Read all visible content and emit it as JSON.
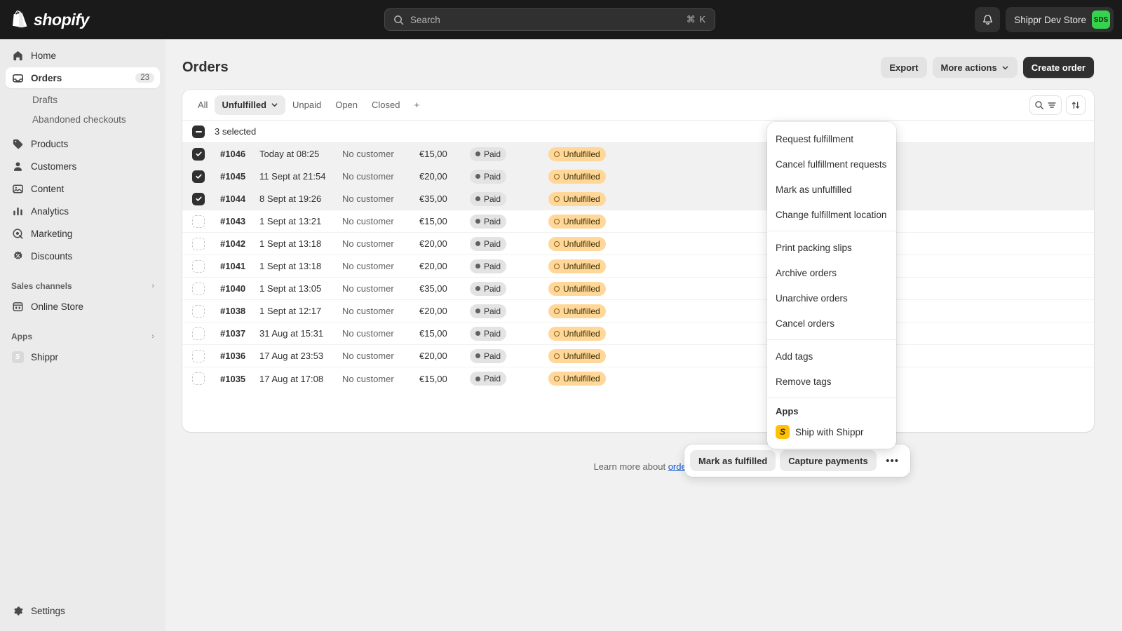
{
  "topbar": {
    "brand": "shopify",
    "search": {
      "placeholder": "Search",
      "shortcut": "⌘ K"
    },
    "store_name": "Shippr Dev Store",
    "store_initials": "SDS",
    "accent_green": "#36d34e"
  },
  "sidebar": {
    "items": [
      {
        "label": "Home",
        "icon": "home-icon",
        "badge": ""
      },
      {
        "label": "Orders",
        "icon": "orders-icon",
        "badge": "23",
        "active": true
      },
      {
        "label": "Products",
        "icon": "products-icon",
        "badge": ""
      },
      {
        "label": "Customers",
        "icon": "customers-icon",
        "badge": ""
      },
      {
        "label": "Content",
        "icon": "content-icon",
        "badge": ""
      },
      {
        "label": "Analytics",
        "icon": "analytics-icon",
        "badge": ""
      },
      {
        "label": "Marketing",
        "icon": "marketing-icon",
        "badge": ""
      },
      {
        "label": "Discounts",
        "icon": "discounts-icon",
        "badge": ""
      }
    ],
    "sub_items": [
      {
        "label": "Drafts"
      },
      {
        "label": "Abandoned checkouts"
      }
    ],
    "sales_channels": {
      "title": "Sales channels",
      "items": [
        {
          "label": "Online Store",
          "icon": "store-icon"
        }
      ]
    },
    "apps": {
      "title": "Apps",
      "items": [
        {
          "label": "Shippr",
          "icon": "shippr-icon"
        }
      ]
    },
    "settings": {
      "label": "Settings",
      "icon": "gear-icon"
    }
  },
  "page": {
    "title": "Orders",
    "actions": {
      "export": "Export",
      "more_actions": "More actions",
      "create_order": "Create order"
    }
  },
  "tabs": [
    {
      "label": "All",
      "active": false
    },
    {
      "label": "Unfulfilled",
      "active": true,
      "has_chevron": true
    },
    {
      "label": "Unpaid",
      "active": false
    },
    {
      "label": "Open",
      "active": false
    },
    {
      "label": "Closed",
      "active": false
    },
    {
      "label": "+",
      "active": false
    }
  ],
  "table": {
    "selected_label": "3 selected",
    "rows": [
      {
        "order": "#1046",
        "date": "Today at 08:25",
        "customer": "No customer",
        "total": "€15,00",
        "payment": "Paid",
        "fulfillment": "Unfulfilled",
        "selected": true
      },
      {
        "order": "#1045",
        "date": "11 Sept at 21:54",
        "customer": "No customer",
        "total": "€20,00",
        "payment": "Paid",
        "fulfillment": "Unfulfilled",
        "selected": true
      },
      {
        "order": "#1044",
        "date": "8 Sept at 19:26",
        "customer": "No customer",
        "total": "€35,00",
        "payment": "Paid",
        "fulfillment": "Unfulfilled",
        "selected": true
      },
      {
        "order": "#1043",
        "date": "1 Sept at 13:21",
        "customer": "No customer",
        "total": "€15,00",
        "payment": "Paid",
        "fulfillment": "Unfulfilled",
        "selected": false
      },
      {
        "order": "#1042",
        "date": "1 Sept at 13:18",
        "customer": "No customer",
        "total": "€20,00",
        "payment": "Paid",
        "fulfillment": "Unfulfilled",
        "selected": false
      },
      {
        "order": "#1041",
        "date": "1 Sept at 13:18",
        "customer": "No customer",
        "total": "€20,00",
        "payment": "Paid",
        "fulfillment": "Unfulfilled",
        "selected": false
      },
      {
        "order": "#1040",
        "date": "1 Sept at 13:05",
        "customer": "No customer",
        "total": "€35,00",
        "payment": "Paid",
        "fulfillment": "Unfulfilled",
        "selected": false
      },
      {
        "order": "#1038",
        "date": "1 Sept at 12:17",
        "customer": "No customer",
        "total": "€20,00",
        "payment": "Paid",
        "fulfillment": "Unfulfilled",
        "selected": false
      },
      {
        "order": "#1037",
        "date": "31 Aug at 15:31",
        "customer": "No customer",
        "total": "€15,00",
        "payment": "Paid",
        "fulfillment": "Unfulfilled",
        "selected": false
      },
      {
        "order": "#1036",
        "date": "17 Aug at 23:53",
        "customer": "No customer",
        "total": "€20,00",
        "payment": "Paid",
        "fulfillment": "Unfulfilled",
        "selected": false
      },
      {
        "order": "#1035",
        "date": "17 Aug at 17:08",
        "customer": "No customer",
        "total": "€15,00",
        "payment": "Paid",
        "fulfillment": "Unfulfilled",
        "selected": false
      }
    ]
  },
  "menu": {
    "group1": [
      "Request fulfillment",
      "Cancel fulfillment requests",
      "Mark as unfulfilled",
      "Change fulfillment location"
    ],
    "group2": [
      "Print packing slips",
      "Archive orders",
      "Unarchive orders",
      "Cancel orders"
    ],
    "group3": [
      "Add tags",
      "Remove tags"
    ],
    "apps_title": "Apps",
    "apps_items": [
      {
        "label": "Ship with Shippr",
        "icon": "shippr-icon"
      }
    ]
  },
  "bulk_actions": {
    "mark_fulfilled": "Mark as fulfilled",
    "capture_payments": "Capture payments",
    "more": "•••"
  },
  "footer": {
    "text": "Learn more about ",
    "link": "orders"
  },
  "colors": {
    "badge_unfulfilled_bg": "#ffd799",
    "badge_paid_bg": "#e3e3e3",
    "primary_dark": "#303030",
    "link_blue": "#0a58d0"
  }
}
